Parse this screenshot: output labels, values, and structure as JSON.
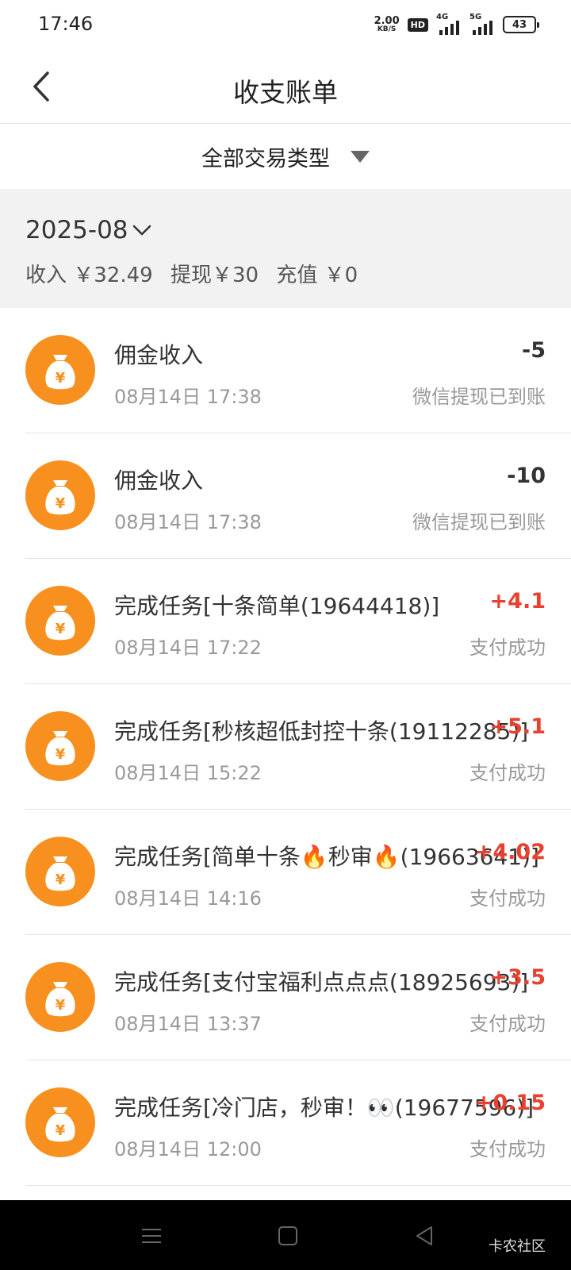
{
  "status_bar": {
    "time": "17:46",
    "net_speed_value": "2.00",
    "net_speed_unit": "KB/S",
    "hd_badge": "HD",
    "signal_1_label": "4G",
    "signal_2_label": "5G",
    "battery": "43"
  },
  "header": {
    "title": "收支账单",
    "back_icon": "chevron-left-icon"
  },
  "filter": {
    "label": "全部交易类型",
    "caret_icon": "triangle-down-icon"
  },
  "summary": {
    "month": "2025-08",
    "month_icon": "chevron-down-icon",
    "income": "收入 ￥32.49",
    "withdraw": "提现￥30",
    "recharge": "充值 ￥0"
  },
  "transactions": [
    {
      "title": "佣金收入",
      "amount": "-5",
      "type": "neg",
      "date": "08月14日 17:38",
      "status": "微信提现已到账"
    },
    {
      "title": "佣金收入",
      "amount": "-10",
      "type": "neg",
      "date": "08月14日 17:38",
      "status": "微信提现已到账"
    },
    {
      "title": "完成任务[十条简单(19644418)]",
      "amount": "+4.1",
      "type": "pos",
      "date": "08月14日 17:22",
      "status": "支付成功"
    },
    {
      "title": "完成任务[秒核超低封控十条(19112285)]",
      "amount": "+5.1",
      "type": "pos",
      "date": "08月14日 15:22",
      "status": "支付成功"
    },
    {
      "title": "完成任务[简单十条🔥秒审🔥(19663641)]",
      "amount": "+4.02",
      "type": "pos",
      "date": "08月14日 14:16",
      "status": "支付成功"
    },
    {
      "title": "完成任务[支付宝福利点点点(18925693)]",
      "amount": "+3.5",
      "type": "pos",
      "date": "08月14日 13:37",
      "status": "支付成功"
    },
    {
      "title": "完成任务[冷门店，秒审！👀(19677596)]",
      "amount": "+0.15",
      "type": "pos",
      "date": "08月14日 12:00",
      "status": "支付成功"
    }
  ],
  "nav": {
    "menu_icon": "menu-icon",
    "home_icon": "square-home-icon",
    "back_icon": "triangle-back-icon",
    "watermark": "卡农社区"
  },
  "colors": {
    "accent_orange": "#f7901e",
    "positive_red": "#e8412f",
    "summary_bg": "#f2f2f2"
  }
}
